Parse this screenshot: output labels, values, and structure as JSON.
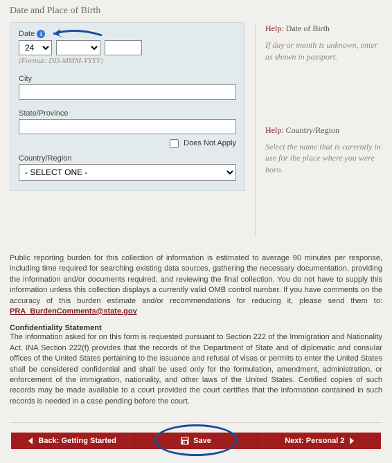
{
  "section_title": "Date and Place of Birth",
  "date": {
    "label": "Date",
    "day_value": "24",
    "month_value": "",
    "year_value": "",
    "format_hint": "(Format: DD-MMM-YYYY)"
  },
  "city": {
    "label": "City",
    "value": ""
  },
  "state": {
    "label": "State/Province",
    "value": "",
    "dna_label": "Does Not Apply",
    "dna_checked": false
  },
  "country": {
    "label": "Country/Region",
    "selected": "- SELECT ONE -"
  },
  "help_dob": {
    "prefix": "Help:",
    "title": "Date of Birth",
    "body": "If day or month is unknown, enter as shown in passport."
  },
  "help_country": {
    "prefix": "Help:",
    "title": "Country/Region",
    "body": "Select the name that is currently in use for the place where you were born."
  },
  "burden": {
    "text": "Public reporting burden for this collection of information is estimated to average 90 minutes per response, including time required for searching existing data sources, gathering the necessary documentation, providing the information and/or documents required, and reviewing the final collection. You do not have to supply this information unless this collection displays a currently valid OMB control number. If you have comments on the accuracy of this burden estimate and/or recommendations for reducing it, please send them to: ",
    "link_text": "PRA_BurdenComments@state.gov"
  },
  "conf": {
    "head": "Confidentiality Statement",
    "body": "The information asked for on this form is requested pursuant to Section 222 of the Immigration and Nationality Act. INA Section 222(f) provides that the records of the Department of State and of diplomatic and consular offices of the United States pertaining to the issuance and refusal of visas or permits to enter the United States shall be considered confidential and shall be used only for the formulation, amendment, administration, or enforcement of the immigration, nationality, and other laws of the United States. Certified copies of such records may be made available to a court provided the court certifies that the information contained in such records is needed in a case pending before the court."
  },
  "nav": {
    "back": "Back: Getting Started",
    "save": "Save",
    "next": "Next: Personal 2"
  }
}
